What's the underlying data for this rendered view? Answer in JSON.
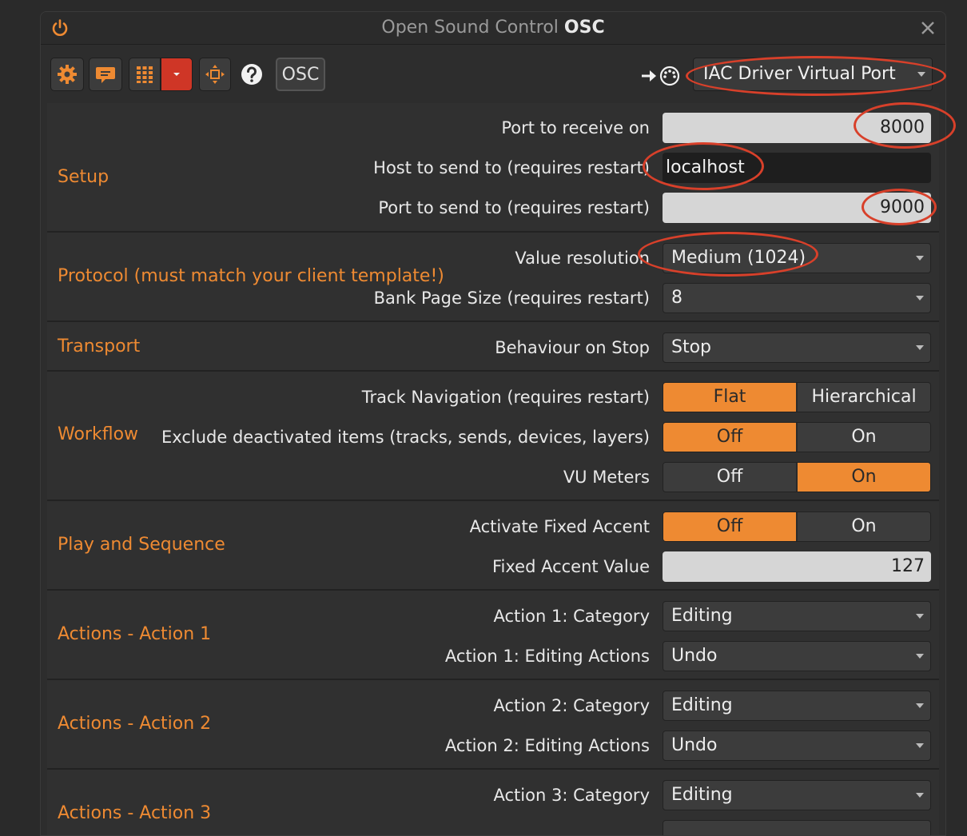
{
  "window": {
    "title_prefix": "Open Sound Control",
    "title_bold": "OSC"
  },
  "toolbar": {
    "osc_label": "OSC",
    "port_select": "IAC Driver Virtual Port"
  },
  "sections": {
    "setup": {
      "title": "Setup",
      "port_receive_label": "Port to receive on",
      "port_receive_value": "8000",
      "host_label": "Host to send to (requires restart)",
      "host_value": "localhost",
      "port_send_label": "Port to send to (requires restart)",
      "port_send_value": "9000"
    },
    "protocol": {
      "title": "Protocol (must match your client template!)",
      "resolution_label": "Value resolution",
      "resolution_value": "Medium (1024)",
      "bank_label": "Bank Page Size (requires restart)",
      "bank_value": "8"
    },
    "transport": {
      "title": "Transport",
      "stop_label": "Behaviour on Stop",
      "stop_value": "Stop"
    },
    "workflow": {
      "title": "Workflow",
      "track_nav_label": "Track Navigation (requires restart)",
      "track_nav_opt1": "Flat",
      "track_nav_opt2": "Hierarchical",
      "exclude_label": "Exclude deactivated items (tracks, sends, devices, layers)",
      "exclude_opt1": "Off",
      "exclude_opt2": "On",
      "vu_label": "VU Meters",
      "vu_opt1": "Off",
      "vu_opt2": "On"
    },
    "play": {
      "title": "Play and Sequence",
      "accent_label": "Activate Fixed Accent",
      "accent_opt1": "Off",
      "accent_opt2": "On",
      "accent_value_label": "Fixed Accent Value",
      "accent_value": "127"
    },
    "action1": {
      "title": "Actions - Action 1",
      "category_label": "Action 1: Category",
      "category_value": "Editing",
      "editing_label": "Action 1: Editing Actions",
      "editing_value": "Undo"
    },
    "action2": {
      "title": "Actions - Action 2",
      "category_label": "Action 2: Category",
      "category_value": "Editing",
      "editing_label": "Action 2: Editing Actions",
      "editing_value": "Undo"
    },
    "action3": {
      "title": "Actions - Action 3",
      "category_label": "Action 3: Category",
      "category_value": "Editing"
    }
  },
  "colors": {
    "accent": "#ee8a32",
    "annotation": "#d8402a",
    "background": "#2d2d2d"
  }
}
